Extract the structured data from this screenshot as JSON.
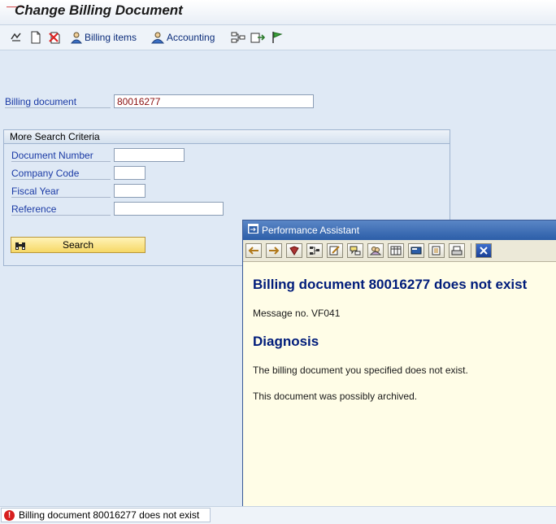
{
  "window": {
    "title": "Change Billing Document"
  },
  "toolbar": {
    "billing_items_label": "Billing items",
    "accounting_label": "Accounting"
  },
  "form": {
    "billing_document_label": "Billing document",
    "billing_document_value": "80016277"
  },
  "search_group": {
    "title": "More Search Criteria",
    "fields": [
      {
        "label": "Document Number",
        "value": ""
      },
      {
        "label": "Company Code",
        "value": ""
      },
      {
        "label": "Fiscal Year",
        "value": ""
      },
      {
        "label": "Reference",
        "value": ""
      }
    ],
    "search_button_label": "Search"
  },
  "assistant": {
    "title": "Performance Assistant",
    "heading": "Billing document 80016277 does not exist",
    "message_no": "Message no. VF041",
    "diagnosis_heading": "Diagnosis",
    "diagnosis_text_1": "The billing document you specified does not exist.",
    "diagnosis_text_2": "This document was possibly archived."
  },
  "status": {
    "message": "Billing document 80016277 does not exist"
  },
  "colors": {
    "error": "#d71f1f",
    "heading": "#001c7a",
    "label": "#1a3aa5"
  }
}
